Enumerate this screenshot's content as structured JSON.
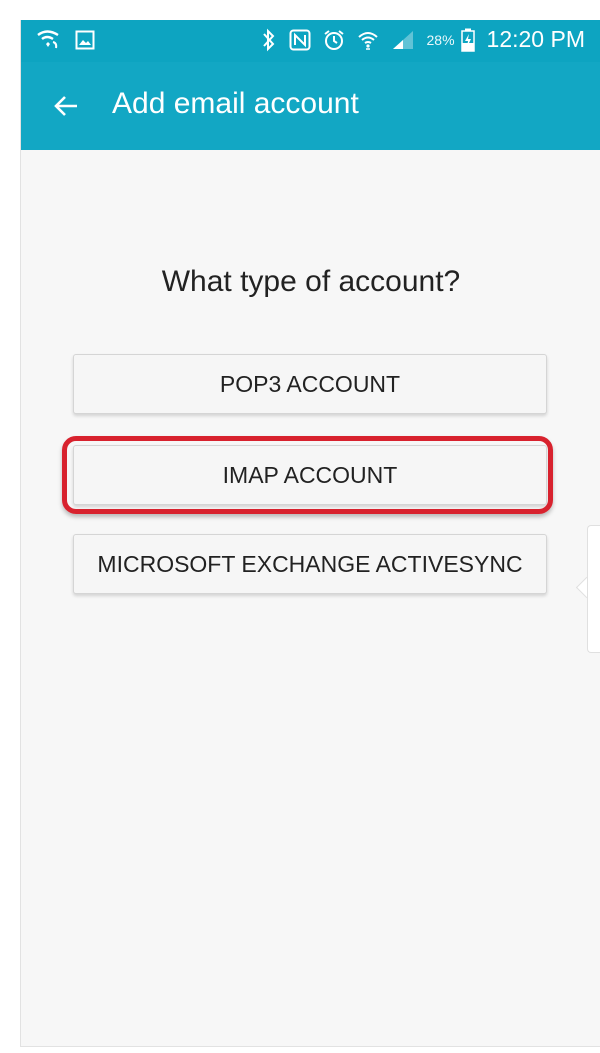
{
  "status_bar": {
    "battery_percent": "28%",
    "time": "12:20 PM",
    "icons": [
      "wifi-calling-icon",
      "image-icon",
      "bluetooth-icon",
      "nfc-icon",
      "alarm-icon",
      "wifi-icon",
      "signal-icon",
      "battery-icon"
    ]
  },
  "app_bar": {
    "title": "Add email account",
    "back_icon": "arrow-left-icon"
  },
  "main": {
    "question": "What type of account?",
    "options": [
      {
        "label": "POP3 ACCOUNT"
      },
      {
        "label": "IMAP ACCOUNT",
        "highlighted": true
      },
      {
        "label": "MICROSOFT EXCHANGE ACTIVESYNC"
      }
    ]
  },
  "colors": {
    "app_bar": "#12a7c4",
    "status_bar": "#0da4c1",
    "highlight": "#d8222e",
    "background": "#f7f7f7"
  }
}
